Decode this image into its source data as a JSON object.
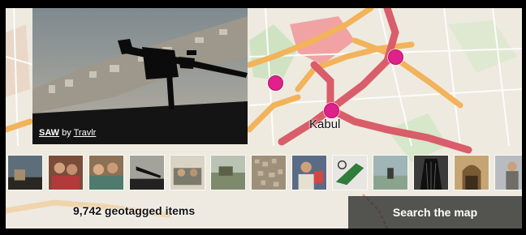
{
  "photo": {
    "title": "SAW",
    "by": "by",
    "author": "Travlr"
  },
  "map": {
    "city_label": "Kabul"
  },
  "filmstrip": {
    "thumbnails": [
      {
        "name": "thumb-helicopter-gunner"
      },
      {
        "name": "thumb-girls-portrait"
      },
      {
        "name": "thumb-children-group"
      },
      {
        "name": "thumb-machine-gun"
      },
      {
        "name": "thumb-soldiers-vehicle"
      },
      {
        "name": "thumb-military-camp"
      },
      {
        "name": "thumb-aerial-city"
      },
      {
        "name": "thumb-child-sign"
      },
      {
        "name": "thumb-peace-graffiti"
      },
      {
        "name": "thumb-rider-landscape"
      },
      {
        "name": "thumb-burqa-woman"
      },
      {
        "name": "thumb-mosque-arch"
      },
      {
        "name": "thumb-street-portrait"
      }
    ]
  },
  "footer": {
    "count_text": "9,742 geotagged items",
    "search_label": "Search the map"
  },
  "colors": {
    "pin": "#e0218a",
    "road_major": "#d95d6a",
    "road_secondary": "#f2b35a",
    "map_bg": "#eeeae0"
  }
}
